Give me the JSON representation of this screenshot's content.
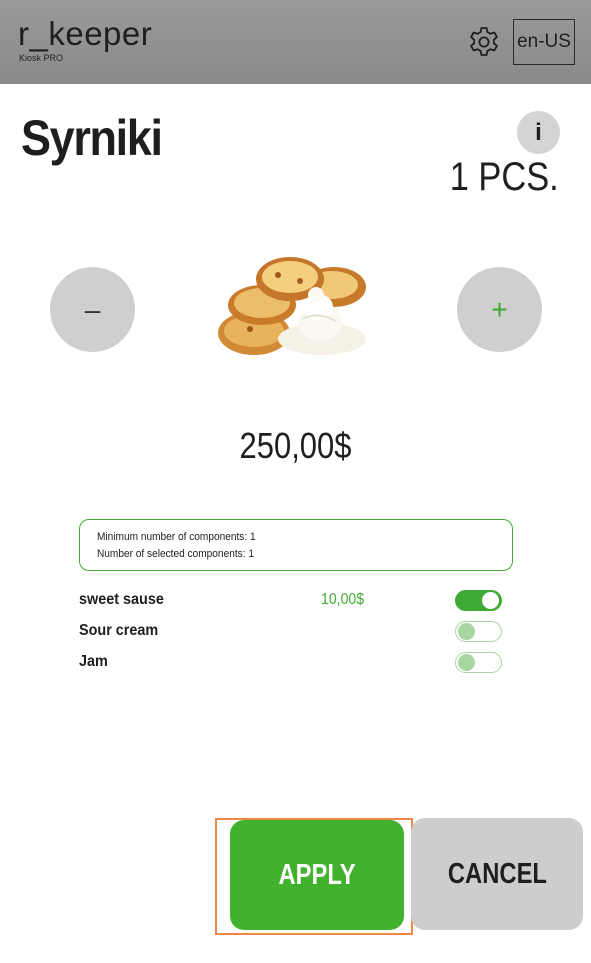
{
  "header": {
    "brand_name": "r_keeper",
    "brand_sub": "Kiosk PRO",
    "language": "en-US"
  },
  "product": {
    "title": "Syrniki",
    "info_label": "i",
    "quantity": "1 PCS.",
    "price": "250,00$",
    "minus_label": "–",
    "plus_label": "+"
  },
  "components": {
    "info_lines": [
      "Minimum number of components: 1",
      "Number of selected components: 1"
    ],
    "items": [
      {
        "name": "sweet sause",
        "price": "10,00$",
        "selected": true
      },
      {
        "name": "Sour cream",
        "price": "",
        "selected": false
      },
      {
        "name": "Jam",
        "price": "",
        "selected": false
      }
    ]
  },
  "actions": {
    "apply": "APPLY",
    "cancel": "CANCEL"
  },
  "colors": {
    "accent_green": "#42b12e",
    "header_grey": "#8f8f8f",
    "button_grey": "#cdcdcd",
    "focus_outline": "#f0874a"
  }
}
